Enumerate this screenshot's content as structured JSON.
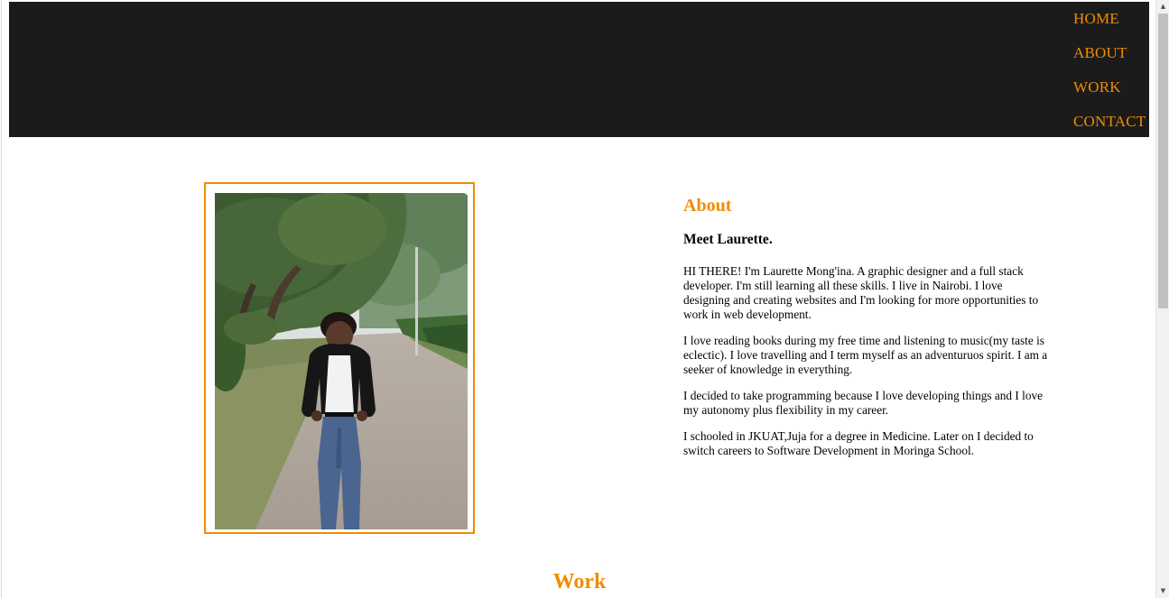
{
  "nav": {
    "items": [
      {
        "label": "HOME"
      },
      {
        "label": "ABOUT"
      },
      {
        "label": "WORK"
      },
      {
        "label": "CONTACT"
      }
    ]
  },
  "about": {
    "title": "About",
    "subtitle": "Meet Laurette.",
    "paragraphs": [
      "HI THERE! I'm Laurette Mong'ina. A graphic designer and a full stack developer. I'm still learning all these skills. I live in Nairobi. I love designing and creating websites and I'm looking for more opportunities to work in web development.",
      "I love reading books during my free time and listening to music(my taste is eclectic). I love travelling and I term myself as an adventuruos spirit. I am a seeker of knowledge in everything.",
      "I decided to take programming because I love developing things and I love my autonomy plus flexibility in my career.",
      "I schooled in JKUAT,Juja for a degree in Medicine. Later on I decided to switch careers to Software Development in Moringa School."
    ]
  },
  "work": {
    "title": "Work"
  },
  "colors": {
    "accent": "#f08c00",
    "header_bg": "#1b1b1b"
  }
}
